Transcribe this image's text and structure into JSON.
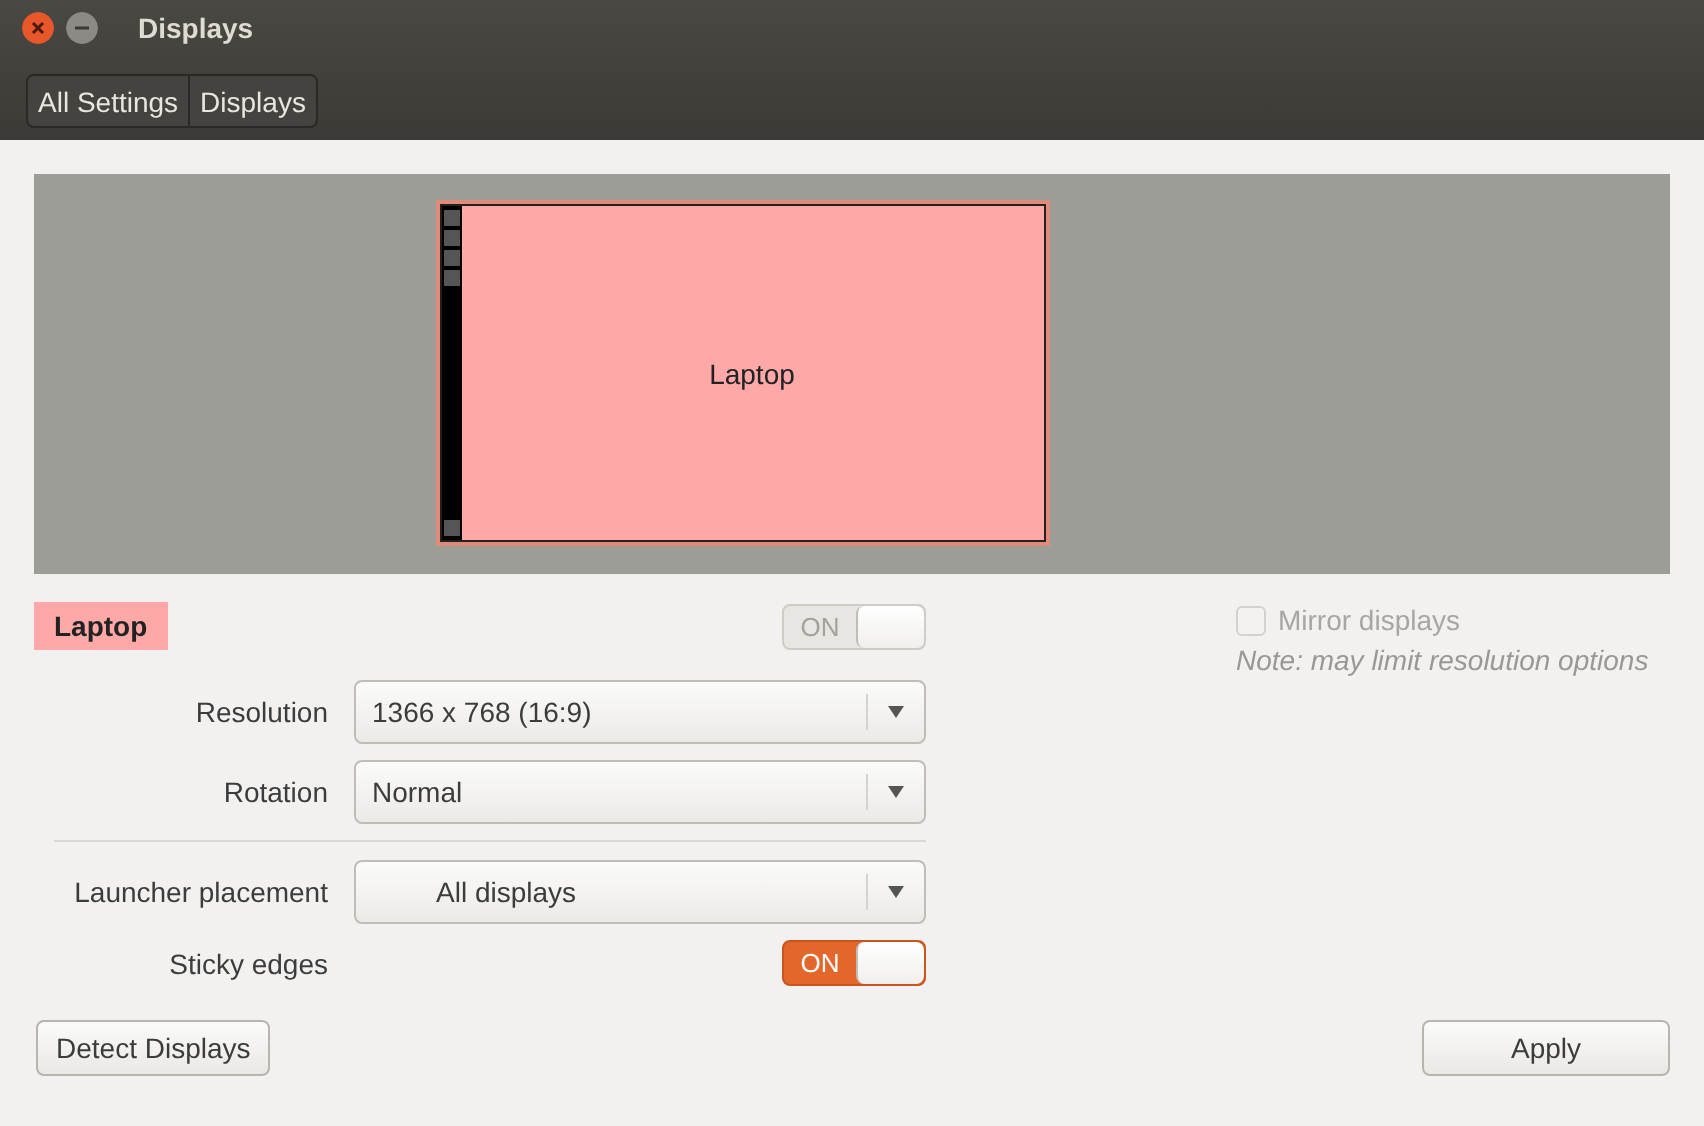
{
  "window": {
    "title": "Displays"
  },
  "breadcrumbs": [
    {
      "label": "All Settings"
    },
    {
      "label": "Displays"
    }
  ],
  "preview": {
    "monitor_label": "Laptop"
  },
  "display": {
    "name": "Laptop",
    "color": "#ffa8a8",
    "switch_label": "ON",
    "on": true,
    "disabled": true
  },
  "display_settings": [
    {
      "kind": "dropdown",
      "label": "Resolution",
      "value": "1366 x 768 (16:9)"
    },
    {
      "kind": "dropdown",
      "label": "Rotation",
      "value": "Normal"
    }
  ],
  "launcher_settings": [
    {
      "kind": "icon-dropdown",
      "label": "Launcher placement",
      "value": "All displays"
    },
    {
      "kind": "switch",
      "label": "Sticky edges",
      "switch_label": "ON",
      "on": true,
      "disabled": false
    }
  ],
  "mirror": {
    "label": "Mirror displays",
    "checked": false,
    "disabled": true,
    "note": "Note: may limit resolution options"
  },
  "buttons": {
    "detect": "Detect Displays",
    "apply": "Apply"
  }
}
